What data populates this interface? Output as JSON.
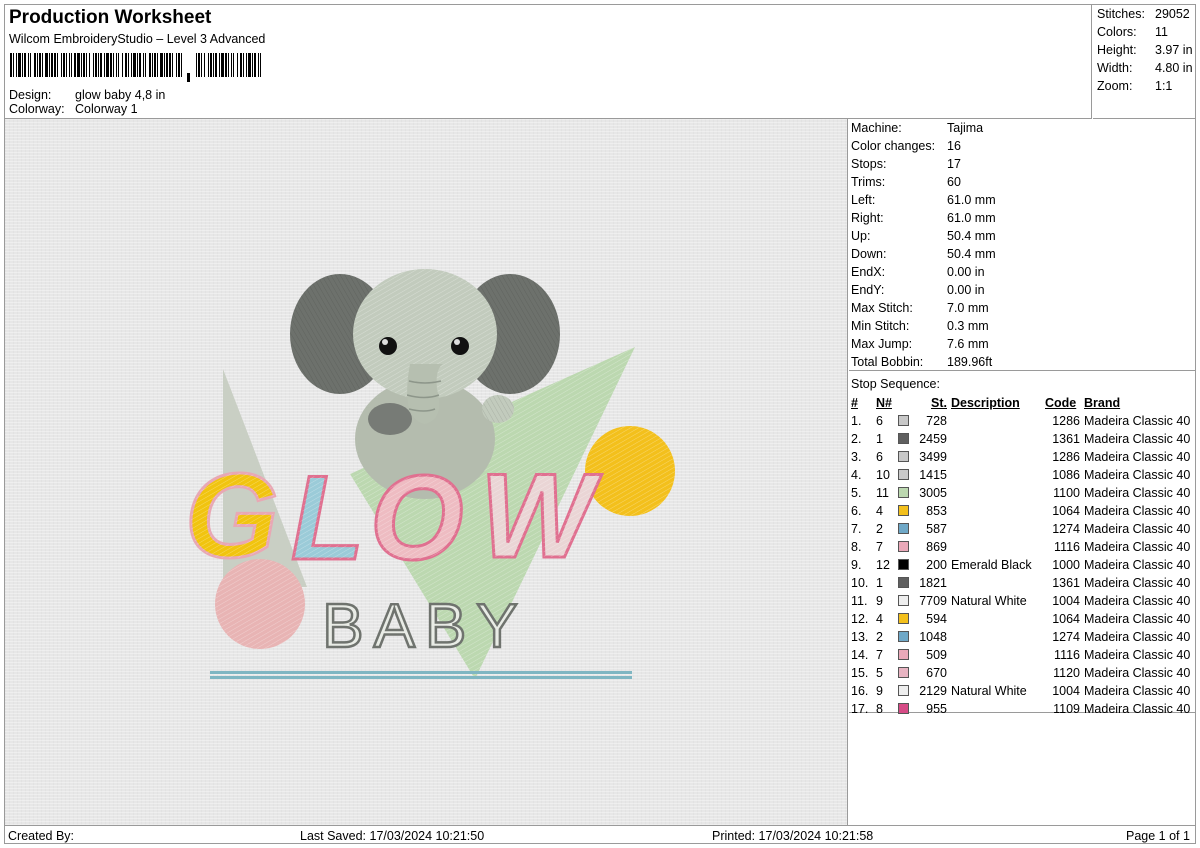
{
  "header": {
    "title": "Production Worksheet",
    "subtitle": "Wilcom EmbroideryStudio – Level 3 Advanced",
    "design_label": "Design:",
    "design_value": "glow baby 4,8 in",
    "colorway_label": "Colorway:",
    "colorway_value": "Colorway 1"
  },
  "summary": {
    "stitches_label": "Stitches:",
    "stitches_value": "29052",
    "colors_label": "Colors:",
    "colors_value": "11",
    "height_label": "Height:",
    "height_value": "3.97 in",
    "width_label": "Width:",
    "width_value": "4.80 in",
    "zoom_label": "Zoom:",
    "zoom_value": "1:1"
  },
  "design": {
    "word1": "GLOW",
    "word2": "BABY"
  },
  "machine": [
    {
      "label": "Machine:",
      "value": "Tajima"
    },
    {
      "label": "Color changes:",
      "value": "16"
    },
    {
      "label": "Stops:",
      "value": "17"
    },
    {
      "label": "Trims:",
      "value": "60"
    },
    {
      "label": "Left:",
      "value": "61.0 mm"
    },
    {
      "label": "Right:",
      "value": "61.0 mm"
    },
    {
      "label": "Up:",
      "value": "50.4 mm"
    },
    {
      "label": "Down:",
      "value": "50.4 mm"
    },
    {
      "label": "EndX:",
      "value": "0.00 in"
    },
    {
      "label": "EndY:",
      "value": "0.00 in"
    },
    {
      "label": "Max Stitch:",
      "value": "7.0 mm"
    },
    {
      "label": "Min Stitch:",
      "value": "0.3 mm"
    },
    {
      "label": "Max Jump:",
      "value": "7.6 mm"
    },
    {
      "label": "Total Bobbin:",
      "value": "189.96ft"
    }
  ],
  "stops": {
    "title": "Stop Sequence:",
    "columns": {
      "num": "#",
      "n": "N#",
      "st": "St.",
      "desc": "Description",
      "code": "Code",
      "brand": "Brand"
    },
    "rows": [
      {
        "num": "1.",
        "n": "6",
        "color": "#c8c8c8",
        "st": "728",
        "desc": "",
        "code": "1286",
        "brand": "Madeira Classic 40"
      },
      {
        "num": "2.",
        "n": "1",
        "color": "#5f5f5f",
        "st": "2459",
        "desc": "",
        "code": "1361",
        "brand": "Madeira Classic 40"
      },
      {
        "num": "3.",
        "n": "6",
        "color": "#c8c8c8",
        "st": "3499",
        "desc": "",
        "code": "1286",
        "brand": "Madeira Classic 40"
      },
      {
        "num": "4.",
        "n": "10",
        "color": "#c9c9c9",
        "st": "1415",
        "desc": "",
        "code": "1086",
        "brand": "Madeira Classic 40"
      },
      {
        "num": "5.",
        "n": "11",
        "color": "#bcd8b0",
        "st": "3005",
        "desc": "",
        "code": "1100",
        "brand": "Madeira Classic 40"
      },
      {
        "num": "6.",
        "n": "4",
        "color": "#f3c01c",
        "st": "853",
        "desc": "",
        "code": "1064",
        "brand": "Madeira Classic 40"
      },
      {
        "num": "7.",
        "n": "2",
        "color": "#6fa8c7",
        "st": "587",
        "desc": "",
        "code": "1274",
        "brand": "Madeira Classic 40"
      },
      {
        "num": "8.",
        "n": "7",
        "color": "#eaa9b9",
        "st": "869",
        "desc": "",
        "code": "1116",
        "brand": "Madeira Classic 40"
      },
      {
        "num": "9.",
        "n": "12",
        "color": "#000000",
        "st": "200",
        "desc": "Emerald Black",
        "code": "1000",
        "brand": "Madeira Classic 40"
      },
      {
        "num": "10.",
        "n": "1",
        "color": "#5f5f5f",
        "st": "1821",
        "desc": "",
        "code": "1361",
        "brand": "Madeira Classic 40"
      },
      {
        "num": "11.",
        "n": "9",
        "color": "#eeeeee",
        "st": "7709",
        "desc": "Natural White",
        "code": "1004",
        "brand": "Madeira Classic 40"
      },
      {
        "num": "12.",
        "n": "4",
        "color": "#f3c01c",
        "st": "594",
        "desc": "",
        "code": "1064",
        "brand": "Madeira Classic 40"
      },
      {
        "num": "13.",
        "n": "2",
        "color": "#6fa8c7",
        "st": "1048",
        "desc": "",
        "code": "1274",
        "brand": "Madeira Classic 40"
      },
      {
        "num": "14.",
        "n": "7",
        "color": "#eaa9b9",
        "st": "509",
        "desc": "",
        "code": "1116",
        "brand": "Madeira Classic 40"
      },
      {
        "num": "15.",
        "n": "5",
        "color": "#e8b4c2",
        "st": "670",
        "desc": "",
        "code": "1120",
        "brand": "Madeira Classic 40"
      },
      {
        "num": "16.",
        "n": "9",
        "color": "#eeeeee",
        "st": "2129",
        "desc": "Natural White",
        "code": "1004",
        "brand": "Madeira Classic 40"
      },
      {
        "num": "17.",
        "n": "8",
        "color": "#d64b86",
        "st": "955",
        "desc": "",
        "code": "1109",
        "brand": "Madeira Classic 40"
      }
    ]
  },
  "footer": {
    "created_by": "Created By:",
    "last_saved": "Last Saved: 17/03/2024 10:21:50",
    "printed": "Printed: 17/03/2024 10:21:58",
    "page": "Page 1 of 1"
  }
}
